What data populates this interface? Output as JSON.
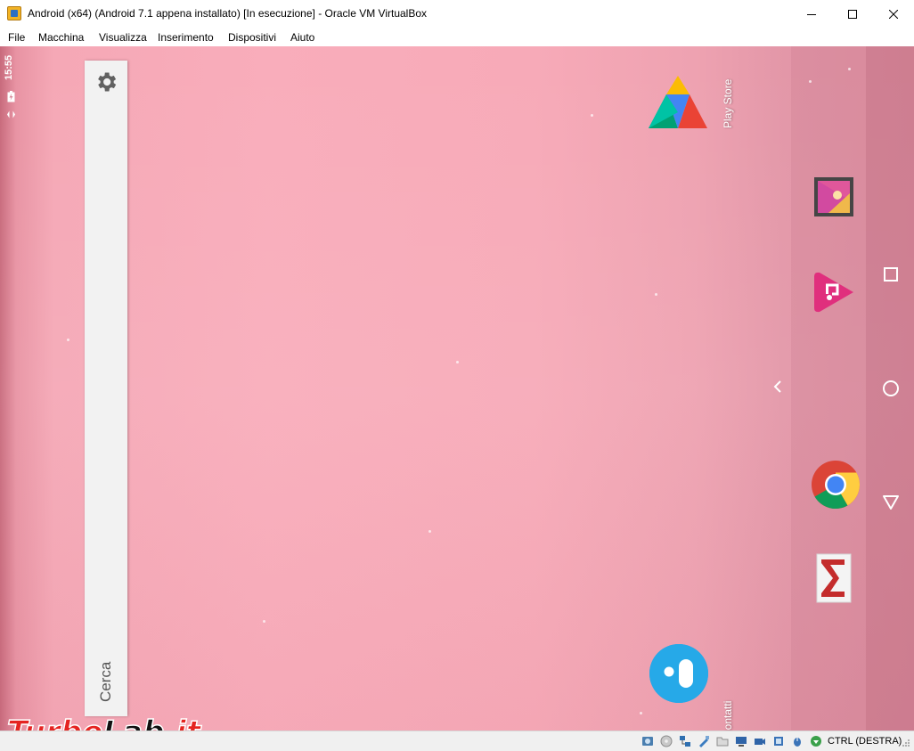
{
  "window": {
    "title": "Android (x64) (Android 7.1 appena installato) [In esecuzione] - Oracle VM VirtualBox",
    "buttons": {
      "minimize": "—",
      "maximize": "☐",
      "close": "✕"
    }
  },
  "menu": [
    "File",
    "Macchina",
    "Visualizza",
    "Inserimento",
    "Dispositivi",
    "Aiuto"
  ],
  "android": {
    "status_time": "15:55",
    "search_label": "Cerca",
    "apps": [
      {
        "label": "Play Store",
        "icon": "play-store-icon"
      },
      {
        "label": "Contatti",
        "icon": "contacts-icon"
      }
    ],
    "dock": [
      "gallery-icon",
      "slideshow-app-icon",
      "chrome-icon",
      "email-icon"
    ],
    "nav": [
      "recents-button",
      "home-button",
      "back-button"
    ]
  },
  "statusbar": {
    "host_key": "CTRL (DESTRA)",
    "icons": [
      "hard-disk-icon",
      "optical-drive-icon",
      "network-icon",
      "usb-icon",
      "shared-folders-icon",
      "display-icon",
      "video-capture-icon",
      "cpu-icon",
      "mouse-integration-icon",
      "keyboard-icon"
    ]
  },
  "watermark": {
    "text": "TurboLab.it"
  }
}
